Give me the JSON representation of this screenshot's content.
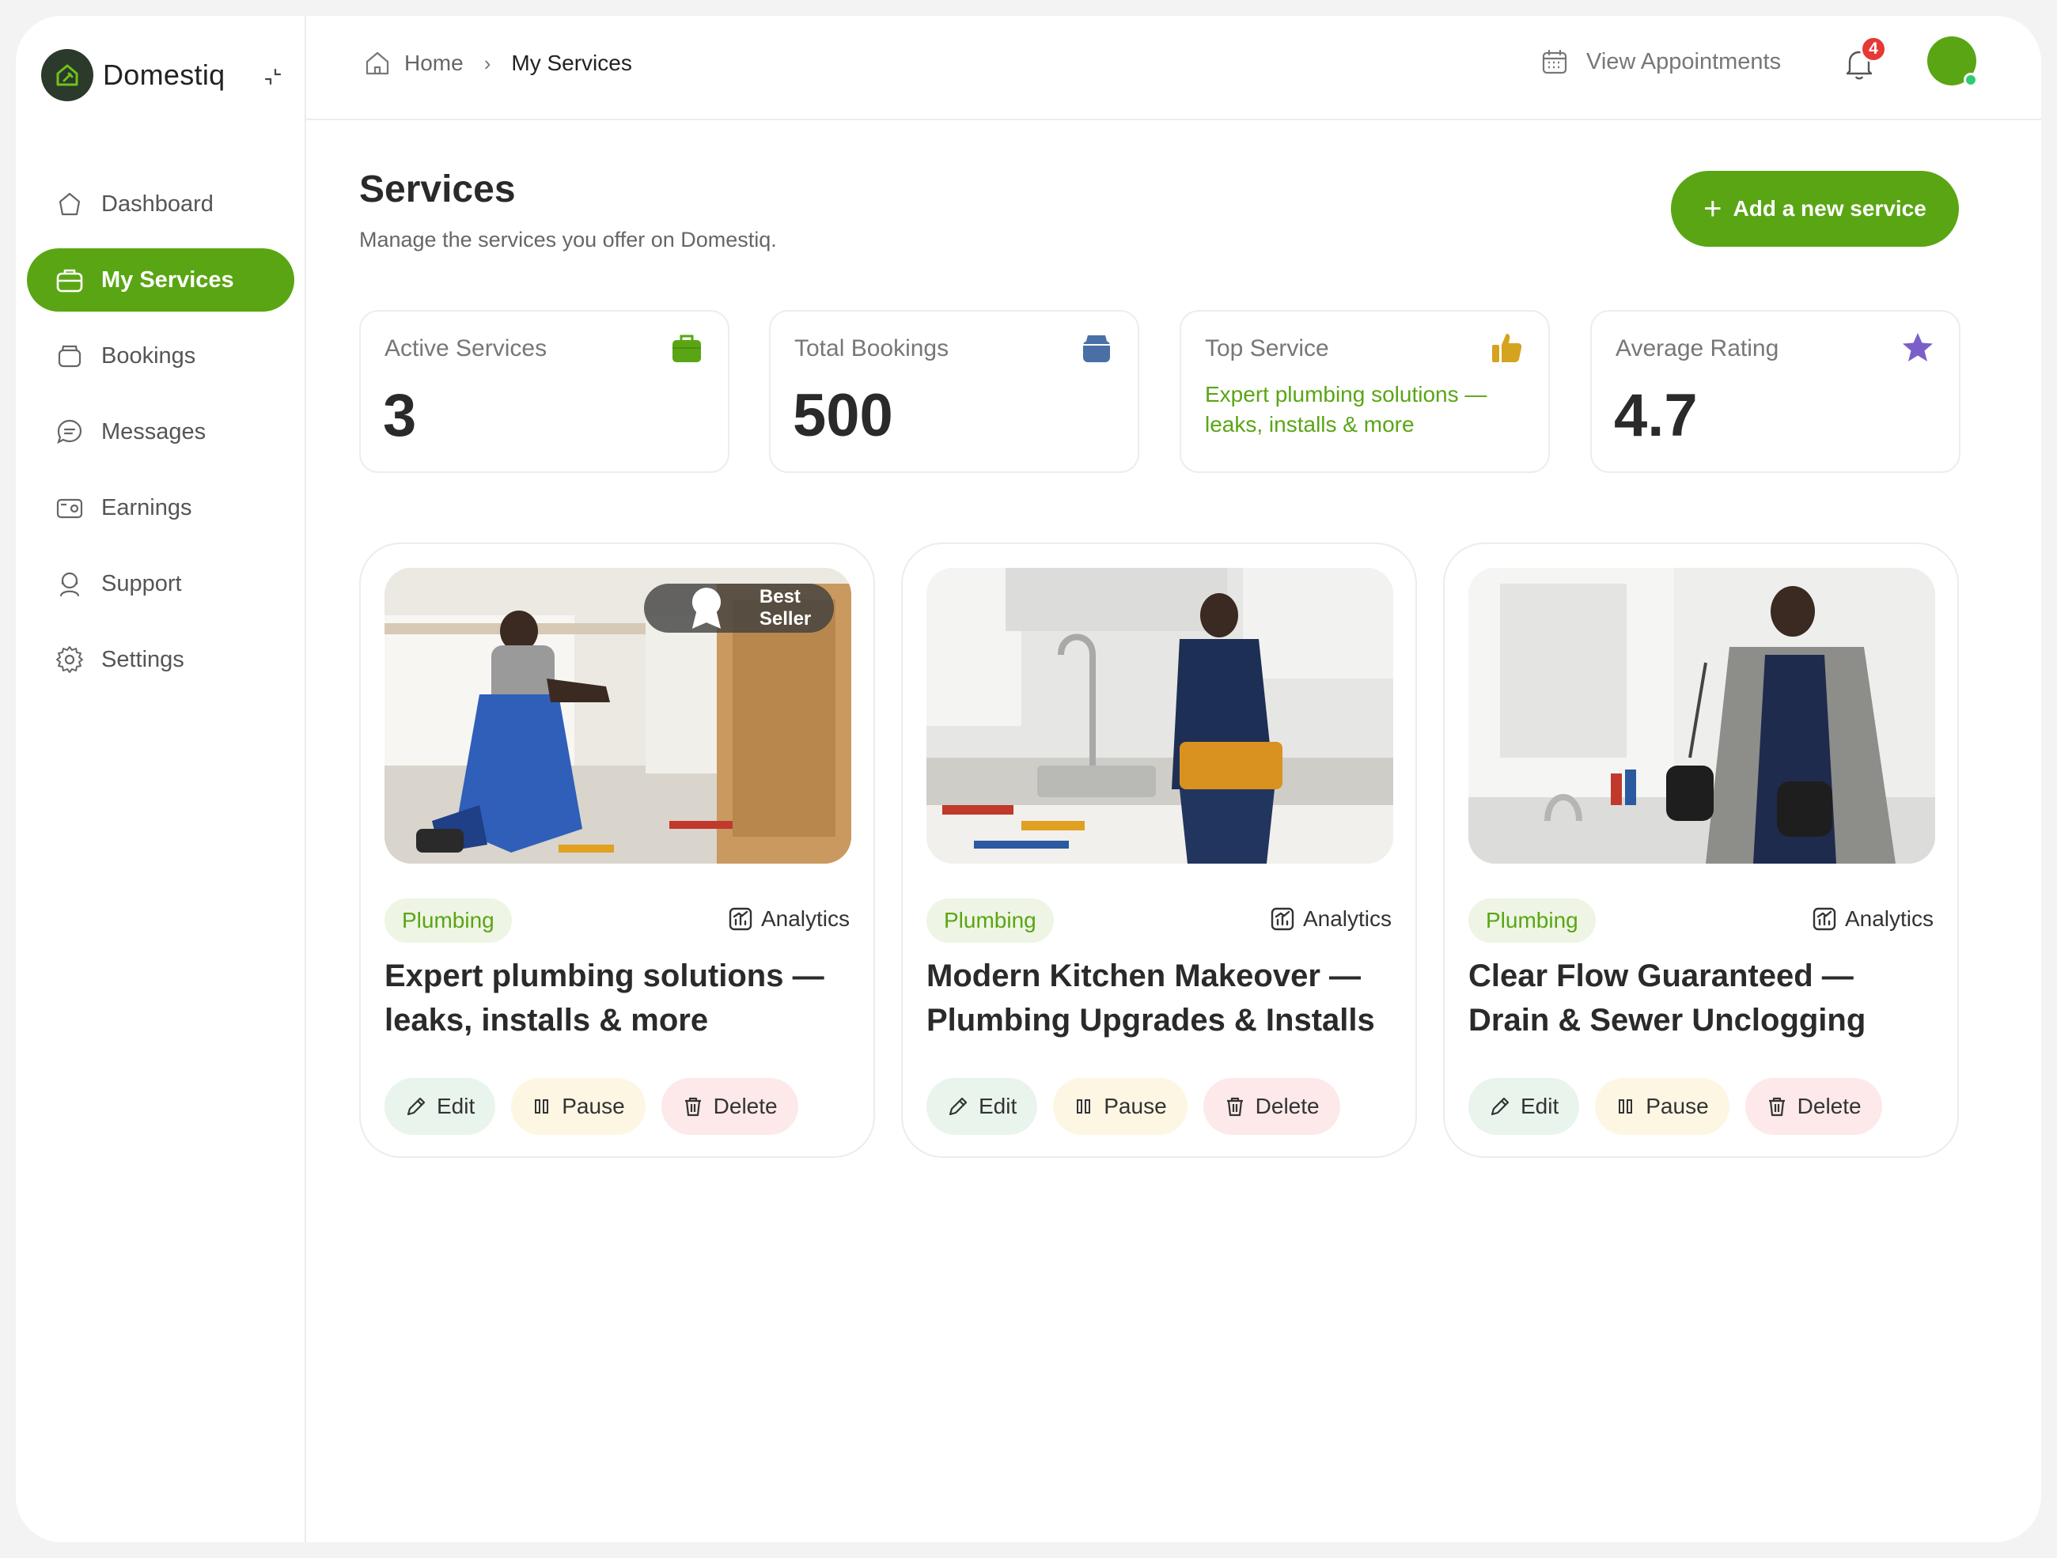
{
  "brand": {
    "name": "Domestiq"
  },
  "sidebar": {
    "items": [
      {
        "label": "Dashboard",
        "icon": "dashboard-icon",
        "active": false
      },
      {
        "label": "My Services",
        "icon": "briefcase-icon",
        "active": true
      },
      {
        "label": "Bookings",
        "icon": "bookings-icon",
        "active": false
      },
      {
        "label": "Messages",
        "icon": "messages-icon",
        "active": false
      },
      {
        "label": "Earnings",
        "icon": "wallet-icon",
        "active": false
      },
      {
        "label": "Support",
        "icon": "support-icon",
        "active": false
      },
      {
        "label": "Settings",
        "icon": "gear-icon",
        "active": false
      }
    ]
  },
  "topbar": {
    "breadcrumb": [
      "Home",
      "My Services"
    ],
    "appointments_label": "View Appointments",
    "notification_count": "4"
  },
  "page": {
    "title": "Services",
    "subtitle": "Manage the services you offer on Domestiq.",
    "add_button": "Add a new service"
  },
  "stats": [
    {
      "label": "Active Services",
      "value": "3",
      "icon": "bag-icon",
      "color": "#5aa514"
    },
    {
      "label": "Total Bookings",
      "value": "500",
      "icon": "bookings-icon",
      "color": "#4a6fa5"
    },
    {
      "label": "Top Service",
      "text": "Expert plumbing solutions — leaks, installs & more",
      "icon": "thumbs-up-icon",
      "color": "#d4a420"
    },
    {
      "label": "Average Rating",
      "value": "4.7",
      "icon": "star-icon",
      "color": "#7b5fc9"
    }
  ],
  "services": [
    {
      "category": "Plumbing",
      "analytics_label": "Analytics",
      "title": "Expert plumbing solutions — leaks, installs & more",
      "badge": "Best Seller",
      "edit": "Edit",
      "pause": "Pause",
      "delete": "Delete"
    },
    {
      "category": "Plumbing",
      "analytics_label": "Analytics",
      "title": "Modern Kitchen Makeover — Plumbing Upgrades & Installs",
      "edit": "Edit",
      "pause": "Pause",
      "delete": "Delete"
    },
    {
      "category": "Plumbing",
      "analytics_label": "Analytics",
      "title": "Clear Flow Guaranteed — Drain & Sewer Unclogging",
      "edit": "Edit",
      "pause": "Pause",
      "delete": "Delete"
    }
  ],
  "colors": {
    "accent": "#5aa514",
    "danger": "#e53935"
  }
}
